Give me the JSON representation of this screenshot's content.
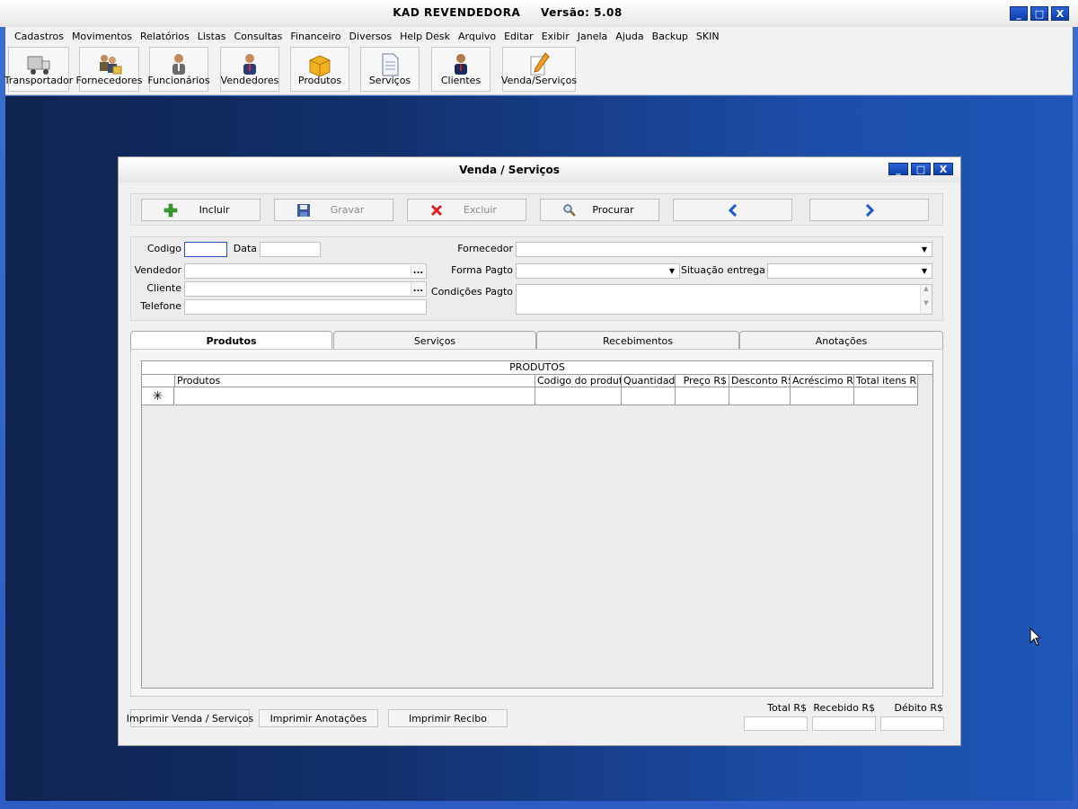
{
  "app": {
    "title": "KAD REVENDEDORA",
    "version": "Versão: 5.08",
    "window_buttons": [
      "_",
      "□",
      "X"
    ]
  },
  "menu": [
    "Cadastros",
    "Movimentos",
    "Relatórios",
    "Listas",
    "Consultas",
    "Financeiro",
    "Diversos",
    "Help Desk",
    "Arquivo",
    "Editar",
    "Exibir",
    "Janela",
    "Ajuda",
    "Backup",
    "SKIN"
  ],
  "toolbar": [
    {
      "label": "Transportador",
      "icon": "truck-icon"
    },
    {
      "label": "Fornecedores",
      "icon": "suppliers-icon"
    },
    {
      "label": "Funcionários",
      "icon": "employee-icon"
    },
    {
      "label": "Vendedores",
      "icon": "seller-icon"
    },
    {
      "label": "Produtos",
      "icon": "box-icon"
    },
    {
      "label": "Serviços",
      "icon": "document-icon"
    },
    {
      "label": "Clientes",
      "icon": "client-icon"
    },
    {
      "label": "Venda/Serviços",
      "icon": "pencil-icon"
    }
  ],
  "child": {
    "title": "Venda / Serviços",
    "window_buttons": [
      "_",
      "□",
      "X"
    ],
    "actions": {
      "incluir": "Incluir",
      "gravar": "Gravar",
      "excluir": "Excluir",
      "procurar": "Procurar"
    },
    "form": {
      "codigo_label": "Codigo",
      "codigo_value": "",
      "data_label": "Data",
      "data_value": "",
      "vendedor_label": "Vendedor",
      "vendedor_value": "",
      "cliente_label": "Cliente",
      "cliente_value": "",
      "telefone_label": "Telefone",
      "telefone_value": "",
      "fornecedor_label": "Fornecedor",
      "fornecedor_value": "",
      "forma_pagto_label": "Forma Pagto",
      "forma_pagto_value": "",
      "situacao_label": "Situação entrega",
      "situacao_value": "",
      "condicoes_label": "Condições Pagto",
      "condicoes_value": "",
      "ellipsis": "..."
    },
    "tabs": [
      "Produtos",
      "Serviços",
      "Recebimentos",
      "Anotações"
    ],
    "active_tab": "Produtos",
    "grid": {
      "caption": "PRODUTOS",
      "columns": [
        "Produtos",
        "Codigo do produto",
        "Quantidade",
        "Preço R$",
        "Desconto R$",
        "Acréscimo R$",
        "Total itens R$"
      ],
      "new_row_marker": "✳"
    },
    "bottom_buttons": [
      "Imprimir Venda / Serviços",
      "Imprimir Anotações",
      "Imprimir Recibo"
    ],
    "totals": {
      "total_label": "Total R$",
      "total_value": "",
      "recebido_label": "Recebido R$",
      "recebido_value": "",
      "debito_label": "Débito R$",
      "debito_value": ""
    }
  },
  "colors": {
    "desktop_left": "#0f2450",
    "desktop_right": "#1f56b8",
    "window_button": "#1a4cc0"
  }
}
